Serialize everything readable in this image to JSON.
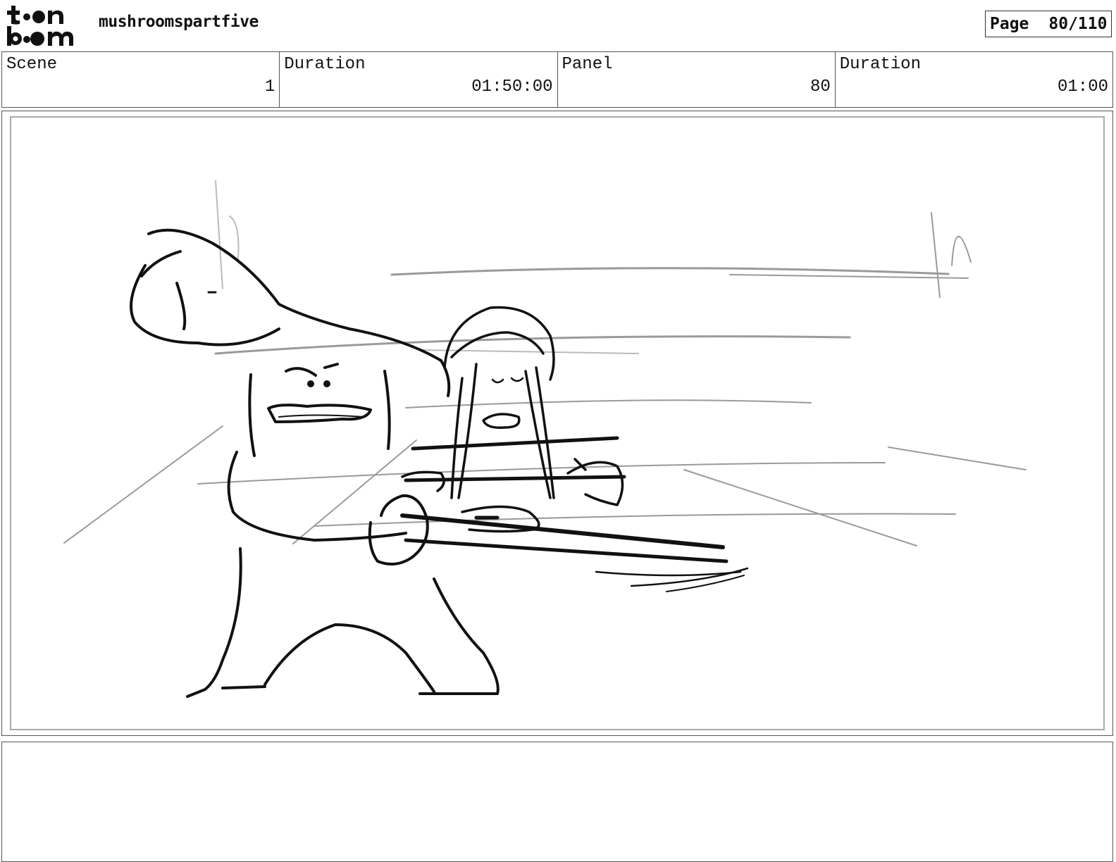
{
  "header": {
    "logo_text": "toon boom",
    "project_name": "mushroomspartfive",
    "page_label": "Page",
    "page_number": "80/110"
  },
  "info": {
    "scene_label": "Scene",
    "scene_value": "1",
    "scene_duration_label": "Duration",
    "scene_duration_value": "01:50:00",
    "panel_label": "Panel",
    "panel_value": "80",
    "panel_duration_label": "Duration",
    "panel_duration_value": "01:00"
  },
  "panel": {
    "image": "storyboard-sketch"
  },
  "notes": {
    "text": ""
  }
}
